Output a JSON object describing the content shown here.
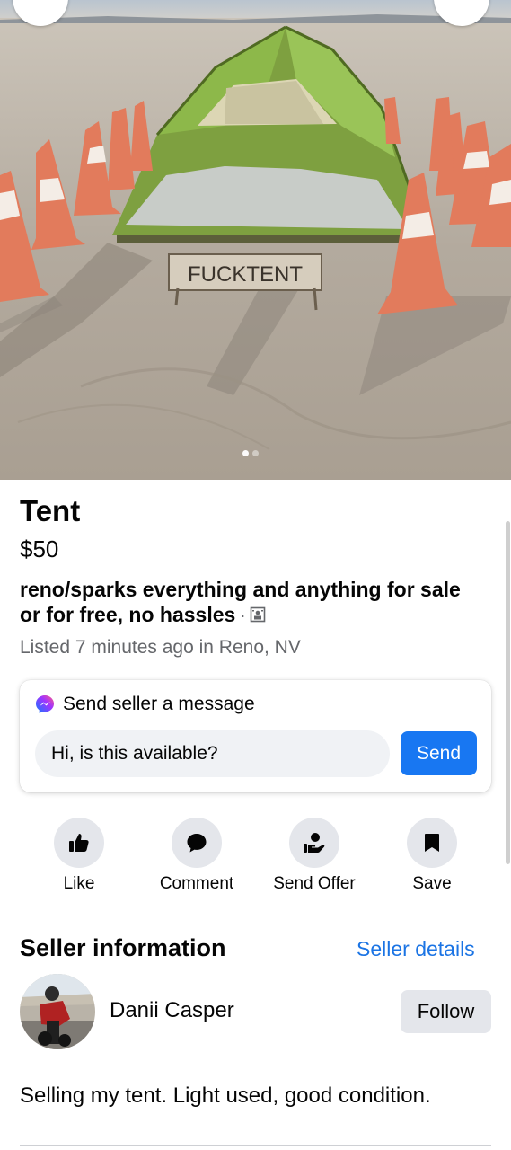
{
  "photo": {
    "sign_text": "FUCKTENT",
    "page_indicator": {
      "count": 2,
      "current": 1
    }
  },
  "listing": {
    "title": "Tent",
    "price": "$50",
    "group_name": "reno/sparks everything and anything for sale or for free, no hassles",
    "group_separator": "·",
    "listed_text": "Listed 7 minutes ago in Reno, NV"
  },
  "message": {
    "header": "Send seller a message",
    "input_value": "Hi, is this available?",
    "send_label": "Send"
  },
  "actions": [
    {
      "label": "Like",
      "icon": "thumbs-up-icon"
    },
    {
      "label": "Comment",
      "icon": "speech-bubble-icon"
    },
    {
      "label": "Send Offer",
      "icon": "offer-hand-icon"
    },
    {
      "label": "Save",
      "icon": "bookmark-icon"
    }
  ],
  "seller": {
    "heading": "Seller information",
    "details_link": "Seller details",
    "name": "Danii Casper",
    "follow_label": "Follow",
    "description": "Selling my tent. Light used, good condition."
  },
  "colors": {
    "accent": "#1877f2",
    "link": "#1b74e4",
    "secondary_text": "#65676b",
    "button_grey": "#e4e6eb"
  }
}
